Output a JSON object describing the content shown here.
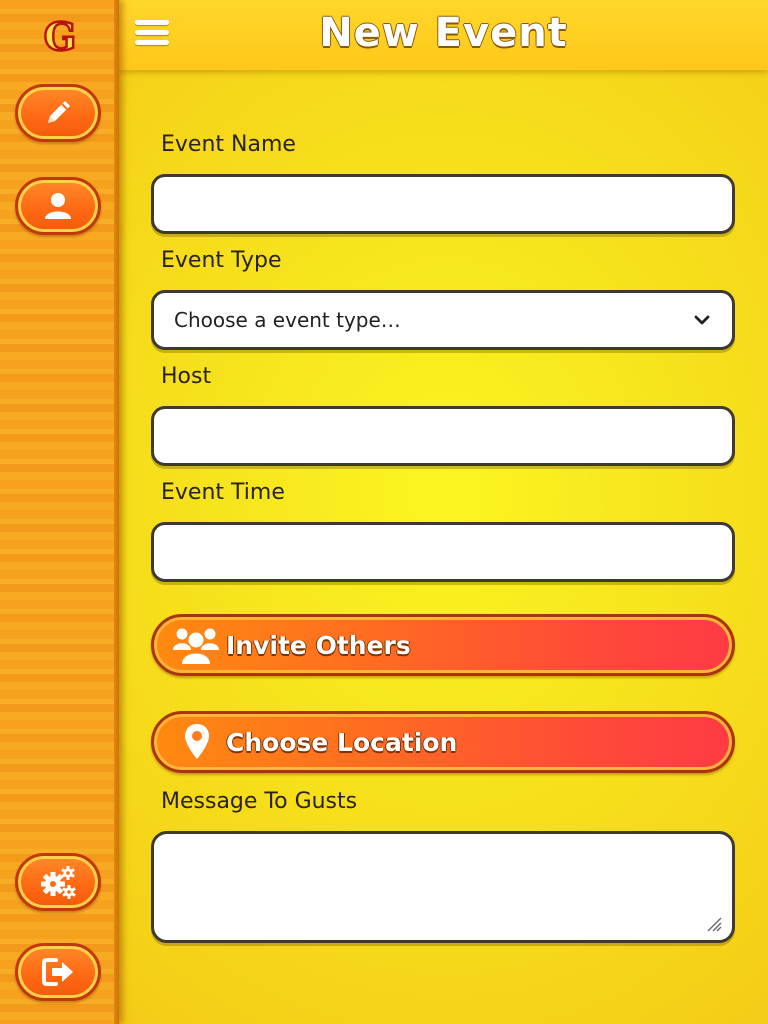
{
  "header": {
    "title": "New Event",
    "menu_icon": "hamburger-menu-icon"
  },
  "sidebar": {
    "logo_text": "G",
    "buttons": [
      {
        "name": "edit-button",
        "icon": "pencil-icon"
      },
      {
        "name": "profile-button",
        "icon": "user-icon"
      },
      {
        "name": "settings-button",
        "icon": "gears-icon"
      },
      {
        "name": "logout-button",
        "icon": "logout-icon"
      }
    ]
  },
  "form": {
    "event_name": {
      "label": "Event Name",
      "value": "",
      "placeholder": ""
    },
    "event_type": {
      "label": "Event Type",
      "selected": "Choose a event type…"
    },
    "host": {
      "label": "Host",
      "value": "",
      "placeholder": ""
    },
    "event_time": {
      "label": "Event Time",
      "value": "",
      "placeholder": ""
    },
    "invite_button": {
      "label": "Invite Others",
      "icon": "group-icon"
    },
    "location_button": {
      "label": "Choose Location",
      "icon": "map-pin-icon"
    },
    "message": {
      "label": "Message To Gusts",
      "value": ""
    }
  },
  "colors": {
    "background": "#f8e41c",
    "sidebar": "#f6a21e",
    "header": "#ffc81a",
    "button_start": "#ff8a10",
    "button_end": "#ff3a44"
  }
}
